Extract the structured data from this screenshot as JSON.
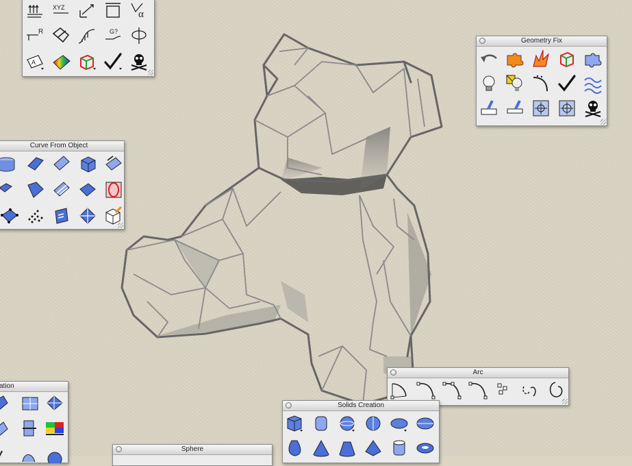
{
  "palettes": {
    "top_left": {
      "title": ""
    },
    "curve_from_object": {
      "title": "Curve From Object"
    },
    "geometry_fix": {
      "title": "Geometry Fix"
    },
    "arc": {
      "title": "Arc"
    },
    "solids_creation": {
      "title": "Solids Creation"
    },
    "sphere": {
      "title": "Sphere"
    },
    "bottom_left": {
      "title": "ation"
    }
  },
  "top_left_tools": {
    "xyz_label": "XYZ",
    "r_label": "R",
    "g_label": "G?",
    "alpha_label": "α",
    "a_label": "A"
  },
  "icons": {
    "top_left": [
      "array-icon",
      "xyz-point-icon",
      "dimension-icon",
      "bounding-box-icon",
      "angle-icon",
      "radius-icon",
      "fold-icon",
      "curvature-icon",
      "continuity-icon",
      "draft-angle-icon",
      "text-object-icon",
      "zebra-analysis-icon",
      "box-edit-icon",
      "check-icon",
      "skull-icon"
    ],
    "curve_from_object": [
      "cylinder-icon",
      "surface-icon",
      "surface-patch-icon",
      "box-icon",
      "extract-curve-icon",
      "duplicate-edge-icon",
      "border-icon",
      "isocurve-icon",
      "contour-icon",
      "intersect-icon",
      "point-grid-icon",
      "point-cloud-icon",
      "text-surface-icon",
      "silhouette-icon",
      "cube-edit-icon"
    ],
    "geometry_fix": [
      "undo-arrow-icon",
      "puzzle-join-icon",
      "explode-icon",
      "box-check-icon",
      "puzzle-icon",
      "lightbulb-icon",
      "show-edges-icon",
      "rebuild-curve-icon",
      "check-icon",
      "wave-icon",
      "flip-normal-icon",
      "align-normal-icon",
      "grid-target-icon",
      "target-icon",
      "skull-icon"
    ],
    "arc": [
      "arc-center-icon",
      "arc-start-end-icon",
      "arc-tangent-icon",
      "arc-three-point-icon",
      "arc-direction-icon",
      "arc-blend-icon",
      "circle-arc-icon"
    ],
    "solids_creation": [
      "box-solid-icon",
      "cylinder-solid-icon",
      "sphere-solid-icon",
      "sphere-alt-icon",
      "ellipsoid-icon",
      "ellipsoid-alt-icon",
      "paraboloid-icon",
      "cone-icon",
      "truncated-cone-icon",
      "pyramid-icon",
      "tube-icon",
      "torus-icon"
    ],
    "bottom_left": [
      "surface-edit-icon",
      "patch-icon",
      "loft-icon",
      "plane-cut-icon",
      "split-icon",
      "color-grid-icon",
      "curve-icon",
      "disk-icon"
    ]
  },
  "colors": {
    "palette_bg": "#ececec",
    "icon_blue": "#4a6fd6",
    "icon_orange": "#f08a1a",
    "paper": "#d9d3c2"
  }
}
